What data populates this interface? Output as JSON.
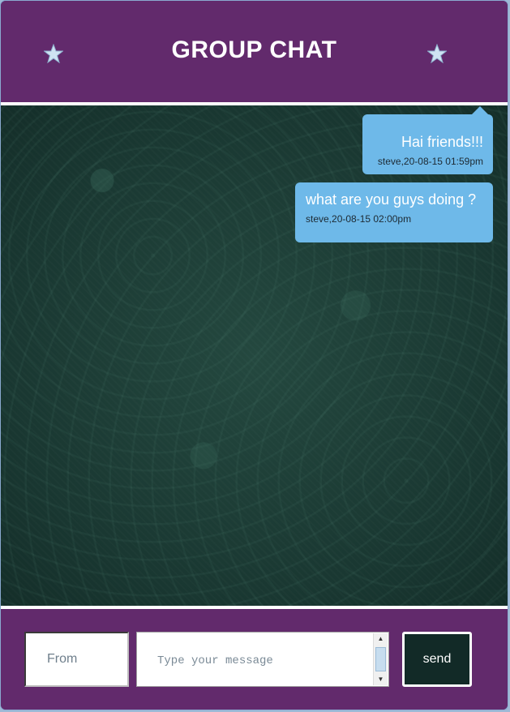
{
  "header": {
    "title": "GROUP CHAT",
    "left_icon": "star-icon",
    "right_icon": "star-icon"
  },
  "messages": [
    {
      "text": "Hai friends!!!",
      "meta": "steve,20-08-15 01:59pm"
    },
    {
      "text": "what are you guys doing ?",
      "meta": "steve,20-08-15 02:00pm"
    }
  ],
  "composer": {
    "from_placeholder": "From",
    "message_placeholder": "Type your message",
    "send_label": "send"
  },
  "colors": {
    "header_bg": "#622a6c",
    "bubble_bg": "#6eb9e9",
    "chat_bg": "#1d3d37",
    "send_bg": "#122a27"
  }
}
